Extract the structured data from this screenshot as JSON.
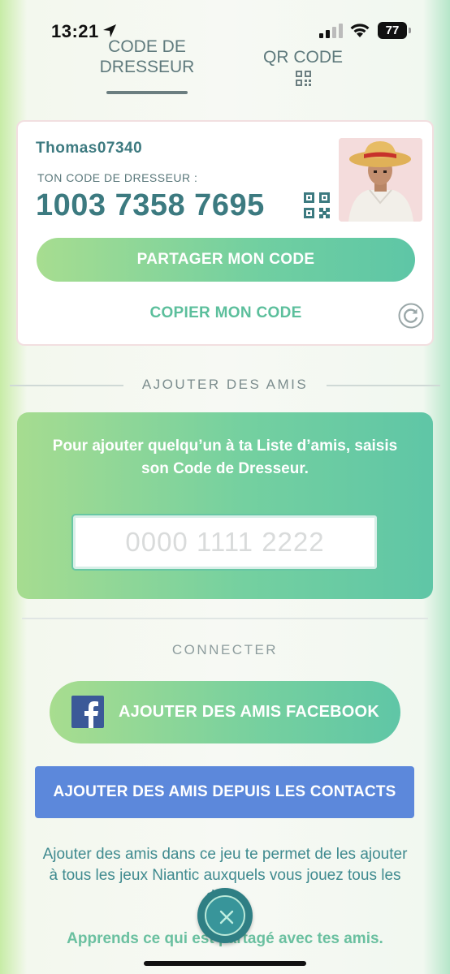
{
  "status_bar": {
    "time": "13:21",
    "battery": "77"
  },
  "tabs": {
    "code": "CODE DE DRESSEUR",
    "qr": "QR CODE"
  },
  "trainer": {
    "username": "Thomas07340",
    "code_label": "TON CODE DE DRESSEUR :",
    "code": "1003 7358 7695",
    "share_label": "PARTAGER MON CODE",
    "copy_label": "COPIER MON CODE"
  },
  "add_friends": {
    "section_title": "AJOUTER DES AMIS",
    "instructions": "Pour ajouter quelqu’un à ta Liste d’amis, saisis son Code de Dresseur.",
    "input_placeholder": "0000 1111 2222"
  },
  "connect": {
    "section_title": "CONNECTER",
    "facebook_label": "AJOUTER DES AMIS FACEBOOK",
    "contacts_label": "AJOUTER DES AMIS DEPUIS LES CONTACTS",
    "info": "Ajouter des amis dans ce jeu te permet de les ajouter à tous les jeux Niantic auxquels vous jouez tous les deux.",
    "learn_more": "Apprends ce qui est partagé avec tes amis."
  },
  "colors": {
    "accent_green": "#5ec6a6",
    "teal_text": "#3c7a80",
    "contacts_blue": "#5c88db",
    "facebook_blue": "#3b5998"
  }
}
